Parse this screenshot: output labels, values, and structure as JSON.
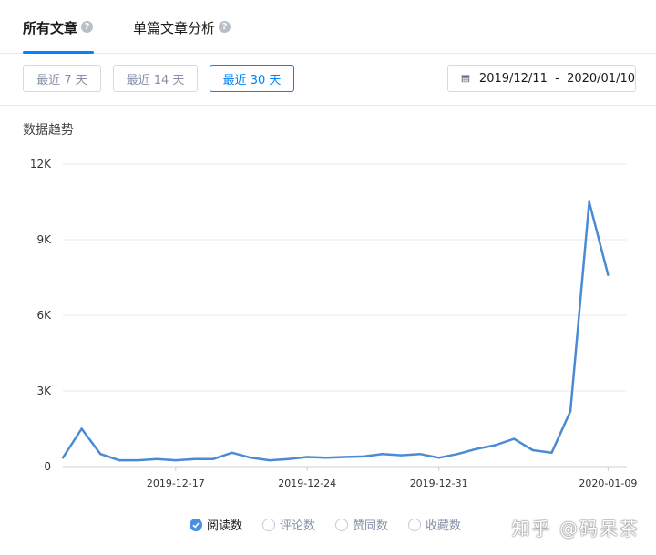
{
  "tabs": [
    {
      "label": "所有文章"
    },
    {
      "label": "单篇文章分析"
    }
  ],
  "icons": {
    "help": "question-circle-icon",
    "calendar": "calendar-icon",
    "check": "check-icon"
  },
  "help_glyph": "?",
  "range_buttons": [
    {
      "label": "最近 7 天"
    },
    {
      "label": "最近 14 天"
    },
    {
      "label": "最近 30 天"
    }
  ],
  "date_range": {
    "text": "2019/12/11  -  2020/01/10"
  },
  "section_title": "数据趋势",
  "legend": [
    {
      "label": "阅读数",
      "checked": true
    },
    {
      "label": "评论数",
      "checked": false
    },
    {
      "label": "赞同数",
      "checked": false
    },
    {
      "label": "收藏数",
      "checked": false
    }
  ],
  "watermark": "知乎 @码呆茶",
  "colors": {
    "accent": "#0084ff",
    "line": "#4a8bd4",
    "grid": "#e8e8e8"
  },
  "chart_data": {
    "type": "line",
    "title": "",
    "xlabel": "",
    "ylabel": "",
    "ylim": [
      0,
      12000
    ],
    "y_ticks": [
      0,
      3000,
      6000,
      9000,
      12000
    ],
    "y_tick_labels": [
      "0",
      "3K",
      "6K",
      "9K",
      "12K"
    ],
    "x_tick_labels": [
      {
        "index": 6,
        "label": "2019-12-17"
      },
      {
        "index": 13,
        "label": "2019-12-24"
      },
      {
        "index": 20,
        "label": "2019-12-31"
      },
      {
        "index": 29,
        "label": "2020-01-09"
      }
    ],
    "x": [
      "2019-12-11",
      "2019-12-12",
      "2019-12-13",
      "2019-12-14",
      "2019-12-15",
      "2019-12-16",
      "2019-12-17",
      "2019-12-18",
      "2019-12-19",
      "2019-12-20",
      "2019-12-21",
      "2019-12-22",
      "2019-12-23",
      "2019-12-24",
      "2019-12-25",
      "2019-12-26",
      "2019-12-27",
      "2019-12-28",
      "2019-12-29",
      "2019-12-30",
      "2019-12-31",
      "2020-01-01",
      "2020-01-02",
      "2020-01-03",
      "2020-01-04",
      "2020-01-05",
      "2020-01-06",
      "2020-01-07",
      "2020-01-08",
      "2020-01-09",
      "2020-01-10"
    ],
    "series": [
      {
        "name": "阅读数",
        "values": [
          350,
          1500,
          500,
          250,
          250,
          300,
          250,
          300,
          300,
          550,
          350,
          250,
          300,
          380,
          350,
          380,
          400,
          500,
          450,
          500,
          350,
          500,
          700,
          850,
          1100,
          650,
          550,
          2200,
          10500,
          7600
        ]
      }
    ],
    "grid": true,
    "legend_position": "bottom"
  }
}
